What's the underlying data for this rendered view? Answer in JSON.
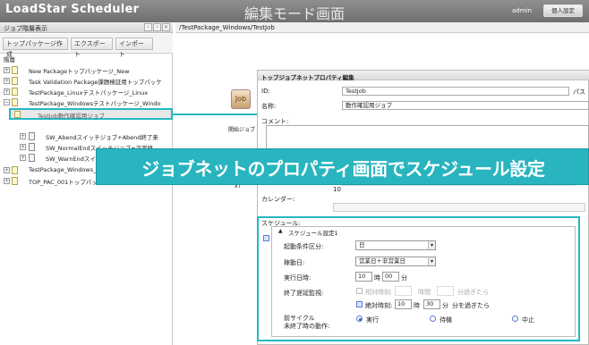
{
  "header": {
    "app_title": "LoadStar Scheduler",
    "mode_title": "編集モード画面",
    "user": "admin",
    "personal_settings": "個人設定"
  },
  "left_pane": {
    "title": "ジョブ階層表示",
    "nav_prev": "‹",
    "nav_next": "›",
    "nav_close": "×",
    "toolbar": {
      "create_top_package": "トップパッケージ作成",
      "export": "エクスポート",
      "import": "インポート"
    },
    "hierarchy_label": "階層",
    "tree": [
      {
        "label": "New Packageトップパッケージ_New"
      },
      {
        "label": "Task Validation Package課題検証用トップパッケ"
      },
      {
        "label": "TestPackage_Linuxテストパッケージ_Linux"
      },
      {
        "label": "TestPackage_Windowsテストパッケージ_Windo"
      },
      {
        "label": "TestJob動作確認用ジョブ"
      },
      {
        "label": "SW_Abendスイッチジョブ+Abend終了来"
      },
      {
        "label": "SW_NormalEndスイッチジョブ+正常終"
      },
      {
        "label": "SW_WarnEndスイッチジョブ"
      },
      {
        "label": "TestPackage_Windows_11"
      },
      {
        "label": "TOP_PAC_001トップパッケー"
      }
    ]
  },
  "right_pane": {
    "path": "/TestPackage_Windows/TestJob",
    "palette": {
      "job": "Job",
      "start_job": "開始ジョブ",
      "x7": "x7"
    },
    "properties": {
      "title": "トップジョブネットプロパティ編集",
      "id_label": "ID:",
      "id_value": "TestJob",
      "id_suffix": "パス",
      "name_label": "名称:",
      "name_value": "動作確認用ジョブ",
      "comment_label": "コメント:",
      "calendar_label": "カレンダー:",
      "time_prefix": "10"
    },
    "schedule": {
      "section_label": "スケジュール:",
      "setting_label": "スケジュール設定1",
      "start_condition_label": "起動条件区分:",
      "start_condition_value": "日",
      "operation_day_label": "稼動日:",
      "operation_day_value": "営業日＋非営業日",
      "exec_time_label": "実行日時:",
      "exec_hour": "10",
      "hour_unit": "時",
      "exec_minute": "00",
      "minute_unit": "分",
      "delay_label": "終了遅延監視:",
      "relative_time_label": "相対時刻:",
      "relative_hours": "時間",
      "relative_after": "分過ぎたら",
      "absolute_time_label": "絶対時刻:",
      "abs_hour": "10",
      "abs_minute": "30",
      "abs_after": "分を過ぎたら",
      "prev_cycle_label": "前サイクル",
      "prev_cycle_label2": "未終了時の動作:",
      "opt_run": "実行",
      "opt_wait": "待機",
      "opt_stop": "中止"
    }
  },
  "banner": {
    "text": "ジョブネットのプロパティ画面でスケジュール設定"
  },
  "colors": {
    "accent": "#29b5bf",
    "header_bg": "#7f7f7f"
  }
}
